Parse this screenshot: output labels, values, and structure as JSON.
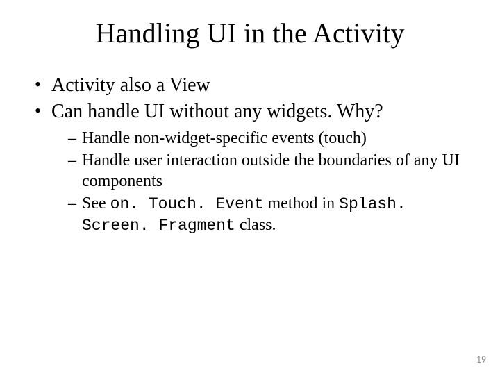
{
  "title": "Handling UI in the Activity",
  "bullets": {
    "b1": "Activity also a View",
    "b2": "Can handle UI without any widgets. Why?",
    "sub": {
      "s1": "Handle non-widget-specific events (touch)",
      "s2": "Handle user interaction outside the boundaries of any UI components",
      "s3a": "See ",
      "s3b": "on. Touch. Event",
      "s3c": " method in ",
      "s3d": "Splash. Screen. Fragment",
      "s3e": " class."
    }
  },
  "page_number": "19"
}
